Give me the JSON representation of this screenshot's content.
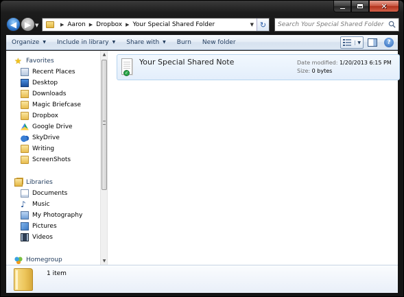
{
  "window": {
    "controls": {
      "minimize": "minimize-icon",
      "maximize": "maximize-icon",
      "close": "close-icon"
    }
  },
  "nav": {
    "back_icon": "arrow-left-icon",
    "forward_icon": "arrow-right-icon"
  },
  "address": {
    "breadcrumbs": [
      "Aaron",
      "Dropbox",
      "Your Special Shared Folder"
    ]
  },
  "search": {
    "placeholder": "Search Your Special Shared Folder"
  },
  "toolbar": {
    "organize": "Organize",
    "include_in_library": "Include in library",
    "share_with": "Share with",
    "burn": "Burn",
    "new_folder": "New folder"
  },
  "sidebar": {
    "favorites_label": "Favorites",
    "favorites": [
      {
        "label": "Recent Places",
        "icon": "recent-places-icon"
      },
      {
        "label": "Desktop",
        "icon": "desktop-icon"
      },
      {
        "label": "Downloads",
        "icon": "downloads-folder-icon"
      },
      {
        "label": "Magic Briefcase",
        "icon": "folder-icon"
      },
      {
        "label": "Dropbox",
        "icon": "folder-icon"
      },
      {
        "label": "Google Drive",
        "icon": "google-drive-icon"
      },
      {
        "label": "SkyDrive",
        "icon": "skydrive-cloud-icon"
      },
      {
        "label": "Writing",
        "icon": "folder-icon"
      },
      {
        "label": "ScreenShots",
        "icon": "folder-icon"
      }
    ],
    "libraries_label": "Libraries",
    "libraries": [
      {
        "label": "Documents",
        "icon": "documents-icon"
      },
      {
        "label": "Music",
        "icon": "music-icon"
      },
      {
        "label": "My Photography",
        "icon": "photography-icon"
      },
      {
        "label": "Pictures",
        "icon": "pictures-icon"
      },
      {
        "label": "Videos",
        "icon": "videos-icon"
      }
    ],
    "homegroup_label": "Homegroup"
  },
  "files": [
    {
      "name": "Your Special Shared Note",
      "date_modified_label": "Date modified:",
      "date_modified": "1/20/2013 6:15 PM",
      "size_label": "Size:",
      "size": "0 bytes"
    }
  ],
  "details": {
    "item_count": "1 item"
  }
}
